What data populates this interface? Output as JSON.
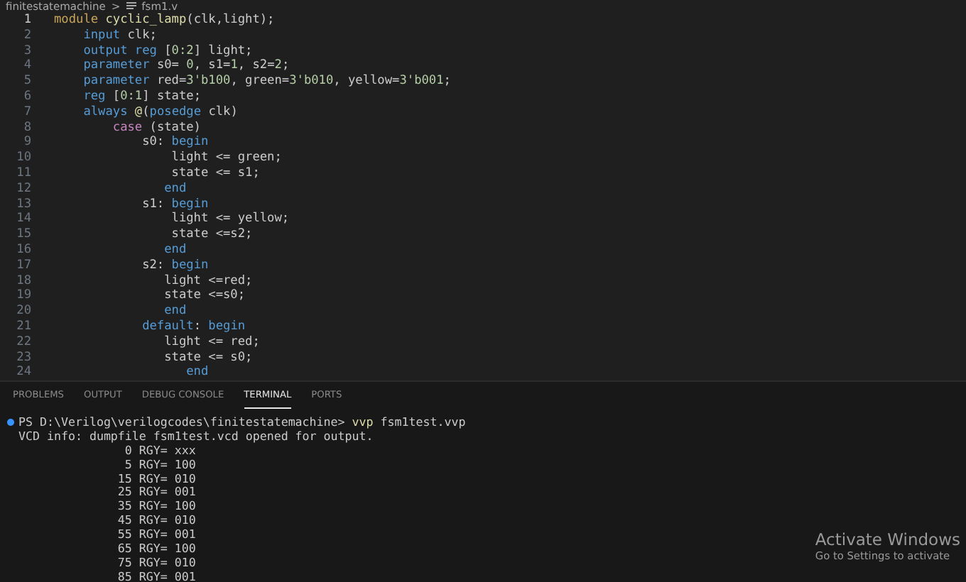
{
  "breadcrumb": {
    "folder": "finitestatemachine",
    "separator": ">",
    "file": "fsm1.v"
  },
  "editor": {
    "lines": [
      {
        "number": "1",
        "selected": true,
        "tokens": [
          {
            "kind": "mod",
            "text": "module"
          },
          {
            "kind": "fn",
            "text": " cyclic_lamp"
          },
          {
            "kind": "txt",
            "text": "(clk,light);"
          }
        ]
      },
      {
        "number": "2",
        "selected": false,
        "tokens": [
          {
            "kind": "kw",
            "text": "    input"
          },
          {
            "kind": "txt",
            "text": " clk;"
          }
        ]
      },
      {
        "number": "3",
        "selected": false,
        "tokens": [
          {
            "kind": "kw",
            "text": "    output reg"
          },
          {
            "kind": "txt",
            "text": " ["
          },
          {
            "kind": "num",
            "text": "0:2"
          },
          {
            "kind": "txt",
            "text": "] light;"
          }
        ]
      },
      {
        "number": "4",
        "selected": false,
        "tokens": [
          {
            "kind": "kw",
            "text": "    parameter"
          },
          {
            "kind": "txt",
            "text": " s0= "
          },
          {
            "kind": "num",
            "text": "0"
          },
          {
            "kind": "txt",
            "text": ", s1="
          },
          {
            "kind": "num",
            "text": "1"
          },
          {
            "kind": "txt",
            "text": ", s2="
          },
          {
            "kind": "num",
            "text": "2"
          },
          {
            "kind": "txt",
            "text": ";"
          }
        ]
      },
      {
        "number": "5",
        "selected": false,
        "tokens": [
          {
            "kind": "kw",
            "text": "    parameter"
          },
          {
            "kind": "txt",
            "text": " red="
          },
          {
            "kind": "num",
            "text": "3'b100"
          },
          {
            "kind": "txt",
            "text": ", green="
          },
          {
            "kind": "num",
            "text": "3'b010"
          },
          {
            "kind": "txt",
            "text": ", yellow="
          },
          {
            "kind": "num",
            "text": "3'b001"
          },
          {
            "kind": "txt",
            "text": ";"
          }
        ]
      },
      {
        "number": "6",
        "selected": false,
        "tokens": [
          {
            "kind": "kw",
            "text": "    reg"
          },
          {
            "kind": "txt",
            "text": " ["
          },
          {
            "kind": "num",
            "text": "0:1"
          },
          {
            "kind": "txt",
            "text": "] state;"
          }
        ]
      },
      {
        "number": "7",
        "selected": false,
        "tokens": [
          {
            "kind": "kw",
            "text": "    always"
          },
          {
            "kind": "fn",
            "text": " @"
          },
          {
            "kind": "txt",
            "text": "("
          },
          {
            "kind": "kw",
            "text": "posedge"
          },
          {
            "kind": "txt",
            "text": " clk)"
          }
        ]
      },
      {
        "number": "8",
        "selected": false,
        "tokens": [
          {
            "kind": "ctl",
            "text": "        case"
          },
          {
            "kind": "txt",
            "text": " (state)"
          }
        ]
      },
      {
        "number": "9",
        "selected": false,
        "tokens": [
          {
            "kind": "txt",
            "text": "            s0: "
          },
          {
            "kind": "kw",
            "text": "begin"
          }
        ]
      },
      {
        "number": "10",
        "selected": false,
        "tokens": [
          {
            "kind": "txt",
            "text": "                light <= green;"
          }
        ]
      },
      {
        "number": "11",
        "selected": false,
        "tokens": [
          {
            "kind": "txt",
            "text": "                state <= s1;"
          }
        ]
      },
      {
        "number": "12",
        "selected": false,
        "tokens": [
          {
            "kind": "kw",
            "text": "               end"
          }
        ]
      },
      {
        "number": "13",
        "selected": false,
        "tokens": [
          {
            "kind": "txt",
            "text": "            s1: "
          },
          {
            "kind": "kw",
            "text": "begin"
          }
        ]
      },
      {
        "number": "14",
        "selected": false,
        "tokens": [
          {
            "kind": "txt",
            "text": "                light <= yellow;"
          }
        ]
      },
      {
        "number": "15",
        "selected": false,
        "tokens": [
          {
            "kind": "txt",
            "text": "                state <=s2;"
          }
        ]
      },
      {
        "number": "16",
        "selected": false,
        "tokens": [
          {
            "kind": "kw",
            "text": "               end"
          }
        ]
      },
      {
        "number": "17",
        "selected": false,
        "tokens": [
          {
            "kind": "txt",
            "text": "            s2: "
          },
          {
            "kind": "kw",
            "text": "begin"
          }
        ]
      },
      {
        "number": "18",
        "selected": false,
        "tokens": [
          {
            "kind": "txt",
            "text": "               light <=red;"
          }
        ]
      },
      {
        "number": "19",
        "selected": false,
        "tokens": [
          {
            "kind": "txt",
            "text": "               state <=s0;"
          }
        ]
      },
      {
        "number": "20",
        "selected": false,
        "tokens": [
          {
            "kind": "kw",
            "text": "               end"
          }
        ]
      },
      {
        "number": "21",
        "selected": false,
        "tokens": [
          {
            "kind": "kw",
            "text": "            default"
          },
          {
            "kind": "txt",
            "text": ": "
          },
          {
            "kind": "kw",
            "text": "begin"
          }
        ]
      },
      {
        "number": "22",
        "selected": false,
        "tokens": [
          {
            "kind": "txt",
            "text": "               light <= red;"
          }
        ]
      },
      {
        "number": "23",
        "selected": false,
        "tokens": [
          {
            "kind": "txt",
            "text": "               state <= s0;"
          }
        ]
      },
      {
        "number": "24",
        "selected": false,
        "tokens": [
          {
            "kind": "kw",
            "text": "                  end"
          }
        ]
      }
    ]
  },
  "panel": {
    "tabs": [
      {
        "label": "PROBLEMS",
        "selected": false
      },
      {
        "label": "OUTPUT",
        "selected": false
      },
      {
        "label": "DEBUG CONSOLE",
        "selected": false
      },
      {
        "label": "TERMINAL",
        "selected": true
      },
      {
        "label": "PORTS",
        "selected": false
      }
    ],
    "terminal": {
      "lines": [
        {
          "kind": "prompt",
          "tokens": [
            {
              "kind": "txt",
              "text": "PS D:\\Verilog\\verilogcodes\\finitestatemachine> "
            },
            {
              "kind": "fn",
              "text": "vvp"
            },
            {
              "kind": "txt",
              "text": " fsm1test.vvp"
            }
          ]
        },
        {
          "kind": "output",
          "tokens": [
            {
              "kind": "txt",
              "text": "VCD info: dumpfile fsm1test.vcd opened for output."
            }
          ]
        },
        {
          "kind": "output",
          "tokens": [
            {
              "kind": "txt",
              "text": "               0 RGY= xxx"
            }
          ]
        },
        {
          "kind": "output",
          "tokens": [
            {
              "kind": "txt",
              "text": "               5 RGY= 100"
            }
          ]
        },
        {
          "kind": "output",
          "tokens": [
            {
              "kind": "txt",
              "text": "              15 RGY= 010"
            }
          ]
        },
        {
          "kind": "output",
          "tokens": [
            {
              "kind": "txt",
              "text": "              25 RGY= 001"
            }
          ]
        },
        {
          "kind": "output",
          "tokens": [
            {
              "kind": "txt",
              "text": "              35 RGY= 100"
            }
          ]
        },
        {
          "kind": "output",
          "tokens": [
            {
              "kind": "txt",
              "text": "              45 RGY= 010"
            }
          ]
        },
        {
          "kind": "output",
          "tokens": [
            {
              "kind": "txt",
              "text": "              55 RGY= 001"
            }
          ]
        },
        {
          "kind": "output",
          "tokens": [
            {
              "kind": "txt",
              "text": "              65 RGY= 100"
            }
          ]
        },
        {
          "kind": "output",
          "tokens": [
            {
              "kind": "txt",
              "text": "              75 RGY= 010"
            }
          ]
        },
        {
          "kind": "output",
          "tokens": [
            {
              "kind": "txt",
              "text": "              85 RGY= 001"
            }
          ]
        }
      ]
    }
  },
  "activation_notice": {
    "title": "Activate Windows",
    "subtitle": "Go to Settings to activate"
  }
}
